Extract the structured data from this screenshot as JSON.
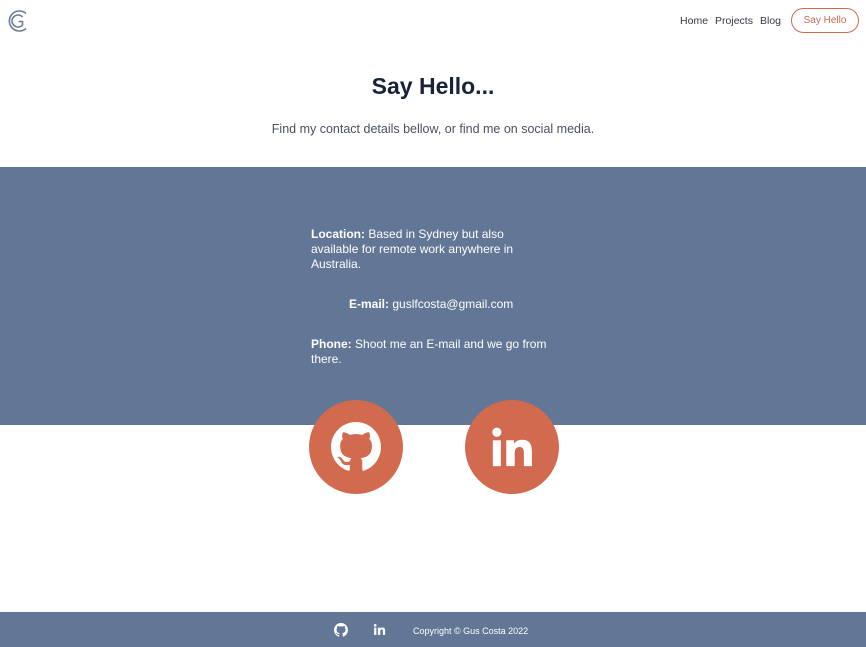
{
  "header": {
    "logo_icon": "gc-logo-icon",
    "nav": [
      {
        "label": "Home"
      },
      {
        "label": "Projects"
      },
      {
        "label": "Blog"
      }
    ],
    "cta_label": "Say Hello"
  },
  "hero": {
    "title": "Say Hello...",
    "subtitle": "Find my contact details bellow, or find me on social media."
  },
  "contact": {
    "location_label": "Location:",
    "location_value": "Based in Sydney but also available for remote work anywhere in Australia.",
    "email_label": "E-mail:",
    "email_value": "guslfcosta@gmail.com",
    "phone_label": "Phone:",
    "phone_value": "Shoot me an E-mail and we go from there."
  },
  "social": [
    {
      "icon": "github-icon"
    },
    {
      "icon": "linkedin-icon"
    }
  ],
  "footer": {
    "copyright": "Copyright © Gus Costa 2022"
  },
  "colors": {
    "band": "#627696",
    "accent": "#d26a4f",
    "title": "#1a2238"
  }
}
